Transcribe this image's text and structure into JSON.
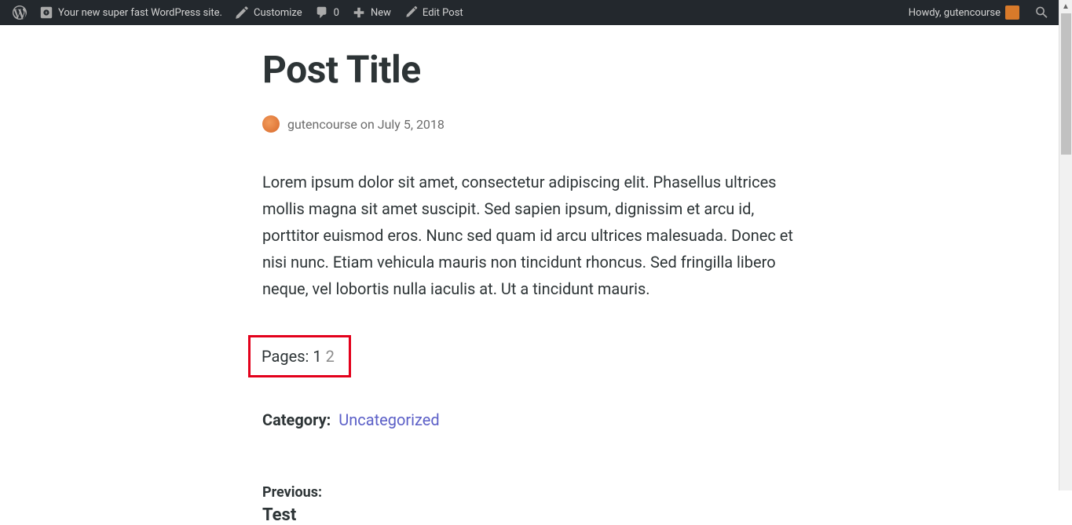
{
  "adminbar": {
    "site_title": "Your new super fast WordPress site.",
    "customize": "Customize",
    "comments_count": "0",
    "new": "New",
    "edit_post": "Edit Post",
    "howdy": "Howdy, gutencourse"
  },
  "post": {
    "title": "Post Title",
    "author": "gutencourse",
    "on": "on",
    "date": "July 5, 2018",
    "body": "Lorem ipsum dolor sit amet, consectetur adipiscing elit. Phasellus ultrices mollis magna sit amet suscipit. Sed sapien ipsum, dignissim et arcu id, porttitor euismod eros. Nunc sed quam id arcu ultrices malesuada. Donec et nisi nunc. Etiam vehicula mauris non tincidunt rhoncus. Sed fringilla libero neque, vel lobortis nulla iaculis at. Ut a tincidunt mauris.",
    "pages_label": "Pages:",
    "page_current": "1",
    "page_other": "2",
    "category_label": "Category:",
    "category_value": "Uncategorized",
    "prev_label": "Previous:",
    "prev_title": "Test"
  }
}
